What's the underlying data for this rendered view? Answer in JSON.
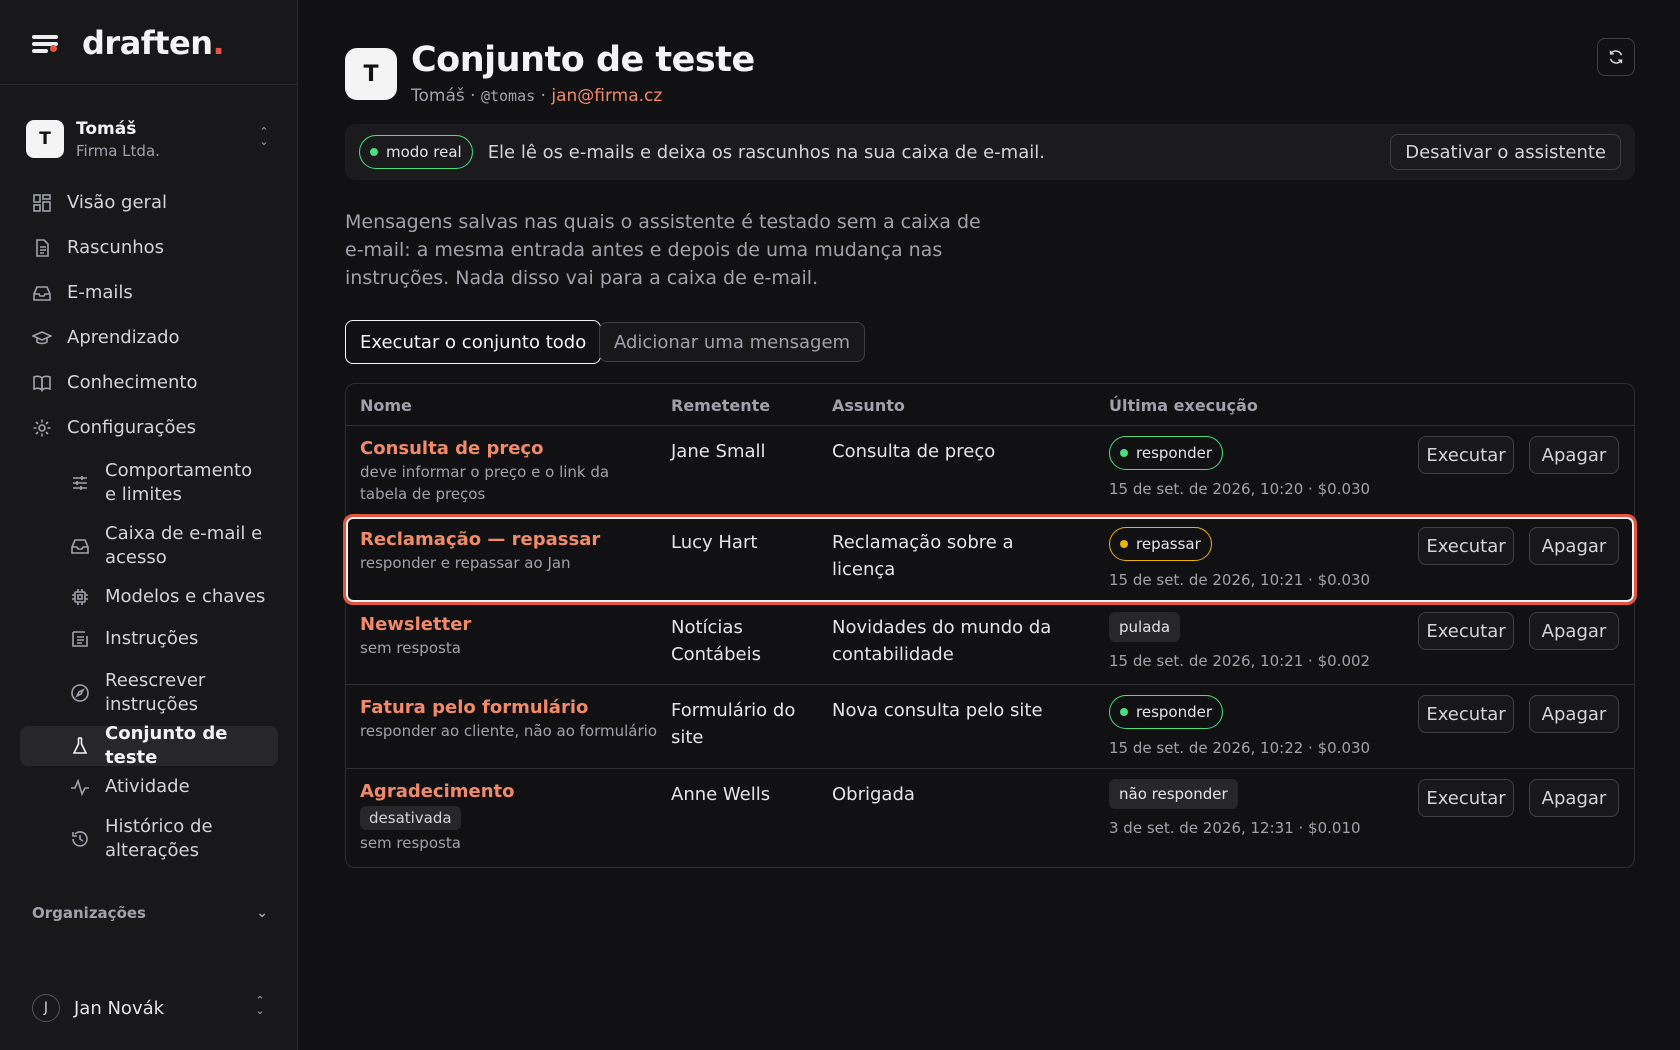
{
  "brand": {
    "name": "draften",
    "dot": "."
  },
  "account": {
    "initial": "T",
    "name": "Tomáš",
    "org": "Firma Ltda."
  },
  "nav": [
    {
      "label": "Visão geral",
      "icon": "grid-icon"
    },
    {
      "label": "Rascunhos",
      "icon": "document-icon"
    },
    {
      "label": "E-mails",
      "icon": "inbox-icon"
    },
    {
      "label": "Aprendizado",
      "icon": "graduation-cap-icon"
    },
    {
      "label": "Conhecimento",
      "icon": "book-icon"
    },
    {
      "label": "Configurações",
      "icon": "gear-icon"
    }
  ],
  "subnav": [
    {
      "label": "Comportamento e limites",
      "icon": "sliders-icon"
    },
    {
      "label": "Caixa de e-mail e acesso",
      "icon": "inbox-icon"
    },
    {
      "label": "Modelos e chaves",
      "icon": "chip-icon"
    },
    {
      "label": "Instruções",
      "icon": "list-icon"
    },
    {
      "label": "Reescrever instruções",
      "icon": "compass-icon"
    },
    {
      "label": "Conjunto de teste",
      "icon": "flask-icon",
      "active": true
    },
    {
      "label": "Atividade",
      "icon": "activity-icon"
    },
    {
      "label": "Histórico de alterações",
      "icon": "history-icon"
    }
  ],
  "orgs_label": "Organizações",
  "user": {
    "initial": "J",
    "name": "Jan Novák"
  },
  "page": {
    "initial": "T",
    "title": "Conjunto de teste",
    "owner": "Tomáš",
    "handle": "@tomas",
    "email": "jan@firma.cz",
    "sep": "·"
  },
  "banner": {
    "mode": "modo real",
    "text": "Ele lê os e-mails e deixa os rascunhos na sua caixa de e-mail.",
    "button": "Desativar o assistente"
  },
  "description": "Mensagens salvas nas quais o assistente é testado sem a caixa de e-mail: a mesma entrada antes e depois de uma mudança nas instruções. Nada disso vai para a caixa de e-mail.",
  "actions": {
    "run_all": "Executar o conjunto todo",
    "add": "Adicionar uma mensagem"
  },
  "table": {
    "headers": {
      "name": "Nome",
      "sender": "Remetente",
      "subject": "Assunto",
      "last_run": "Última execução"
    },
    "run_label": "Executar",
    "delete_label": "Apagar",
    "rows": [
      {
        "name": "Consulta de preço",
        "note": "deve informar o preço e o link da tabela de preços",
        "sender": "Jane Small",
        "subject": "Consulta de preço",
        "status": "responder",
        "status_color": "#4ade80",
        "when": "15 de set. de 2026, 10:20 · $0.030"
      },
      {
        "name": "Reclamação — repassar",
        "note": "responder e repassar ao Jan",
        "sender": "Lucy Hart",
        "subject": "Reclamação sobre a licença",
        "status": "repassar",
        "status_color": "#eab308",
        "when": "15 de set. de 2026, 10:21 · $0.030",
        "highlighted": true
      },
      {
        "name": "Newsletter",
        "note": "sem resposta",
        "sender": "Notícias Contábeis",
        "subject": "Novidades do mundo da contabilidade",
        "status": "pulada",
        "when": "15 de set. de 2026, 10:21 · $0.002"
      },
      {
        "name": "Fatura pelo formulário",
        "note": "responder ao cliente, não ao formulário",
        "sender": "Formulário do site",
        "subject": "Nova consulta pelo site",
        "status": "responder",
        "status_color": "#4ade80",
        "when": "15 de set. de 2026, 10:22 · $0.030"
      },
      {
        "name": "Agradecimento",
        "tag": "desativada",
        "note": "sem resposta",
        "sender": "Anne Wells",
        "subject": "Obrigada",
        "status": "não responder",
        "when": "3 de set. de 2026, 12:31 · $0.010"
      }
    ]
  }
}
